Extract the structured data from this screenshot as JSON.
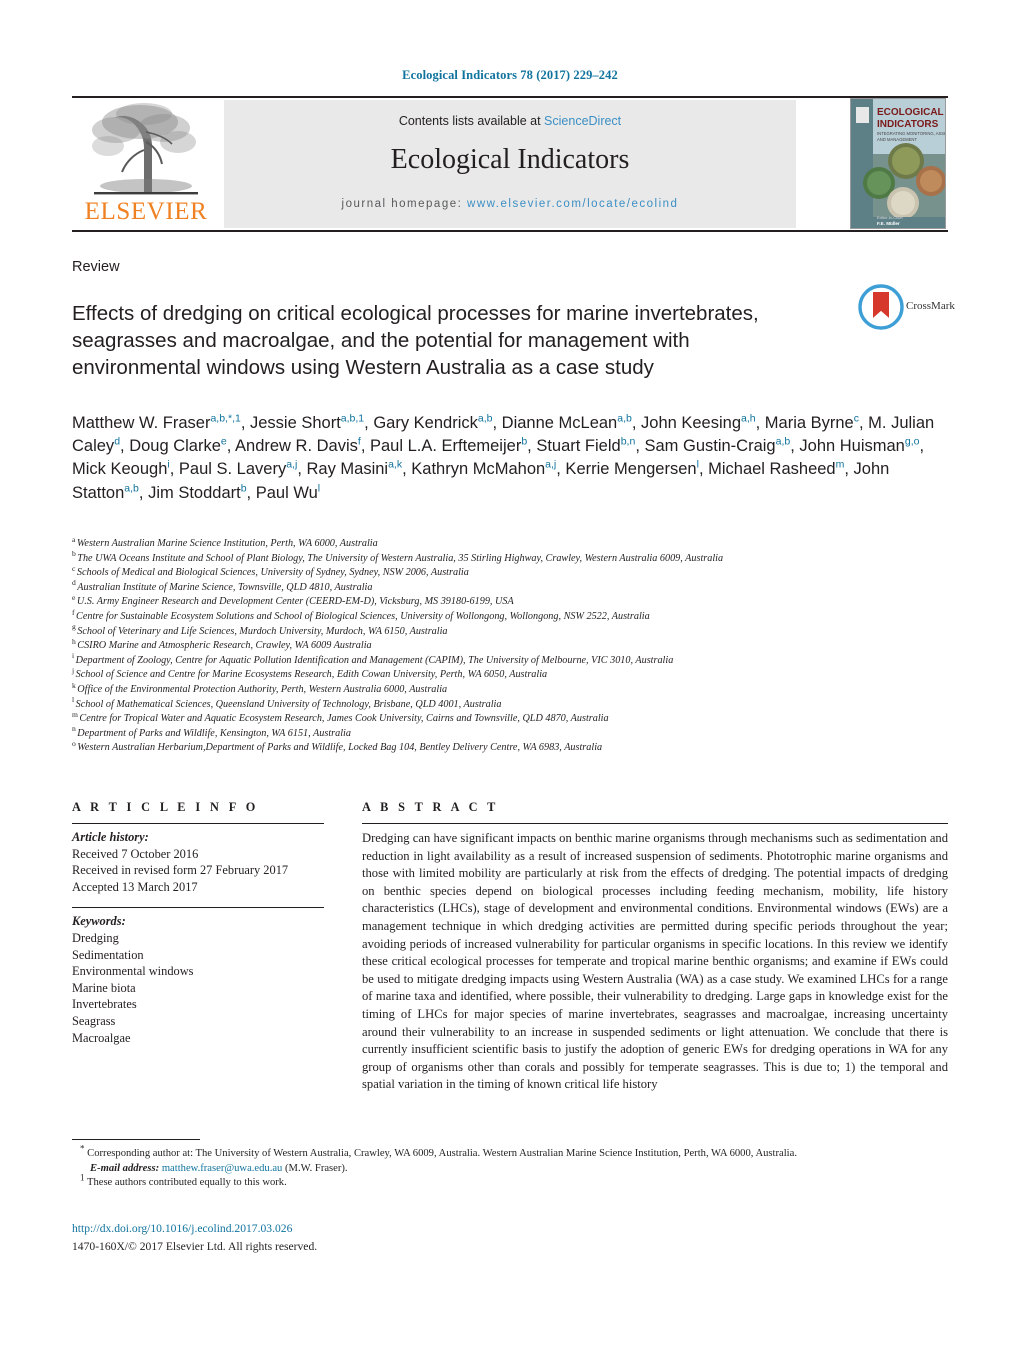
{
  "running_head": "Ecological Indicators 78 (2017) 229–242",
  "masthead": {
    "contents_prefix": "Contents lists available at ",
    "contents_link": "ScienceDirect",
    "journal_title": "Ecological Indicators",
    "homepage_prefix": "journal homepage:",
    "homepage_url": "www.elsevier.com/locate/ecolind",
    "publisher": "ELSEVIER",
    "cover_title_line1": "ECOLOGICAL",
    "cover_title_line2": "INDICATORS"
  },
  "article": {
    "type": "Review",
    "title": "Effects of dredging on critical ecological processes for marine invertebrates, seagrasses and macroalgae, and the potential for management with environmental windows using Western Australia as a case study",
    "crossmark_label": "CrossMark"
  },
  "authors_html": "Matthew W. Fraser<sup>a,b,<span class=\"star\">*</span>,1</sup>, Jessie Short<sup>a,b,1</sup>, Gary Kendrick<sup>a,b</sup>, Dianne McLean<sup>a,b</sup>, John Keesing<sup>a,h</sup>, Maria Byrne<sup>c</sup>, M. Julian Caley<sup>d</sup>, Doug Clarke<sup>e</sup>, Andrew R. Davis<sup>f</sup>, Paul L.A. Erftemeijer<sup>b</sup>, Stuart Field<sup>b,n</sup>, Sam Gustin-Craig<sup>a,b</sup>, John Huisman<sup>g,o</sup>, Mick Keough<sup>i</sup>, Paul S. Lavery<sup>a,j</sup>, Ray Masini<sup>a,k</sup>, Kathryn McMahon<sup>a,j</sup>, Kerrie Mengersen<sup>l</sup>, Michael Rasheed<sup>m</sup>, John Statton<sup>a,b</sup>, Jim Stoddart<sup>b</sup>, Paul Wu<sup>l</sup>",
  "affiliations": [
    {
      "label": "a",
      "text": "Western Australian Marine Science Institution, Perth, WA 6000, Australia"
    },
    {
      "label": "b",
      "text": "The UWA Oceans Institute and School of Plant Biology, The University of Western Australia, 35 Stirling Highway, Crawley, Western Australia 6009, Australia"
    },
    {
      "label": "c",
      "text": "Schools of Medical and Biological Sciences, University of Sydney, Sydney, NSW 2006, Australia"
    },
    {
      "label": "d",
      "text": "Australian Institute of Marine Science, Townsville, QLD 4810, Australia"
    },
    {
      "label": "e",
      "text": "U.S. Army Engineer Research and Development Center (CEERD-EM-D), Vicksburg, MS 39180-6199, USA"
    },
    {
      "label": "f",
      "text": "Centre for Sustainable Ecosystem Solutions and School of Biological Sciences, University of Wollongong, Wollongong, NSW 2522, Australia"
    },
    {
      "label": "g",
      "text": "School of Veterinary and Life Sciences, Murdoch University, Murdoch, WA 6150, Australia"
    },
    {
      "label": "h",
      "text": "CSIRO Marine and Atmospheric Research, Crawley, WA 6009 Australia"
    },
    {
      "label": "i",
      "text": "Department of Zoology, Centre for Aquatic Pollution Identification and Management (CAPIM), The University of Melbourne, VIC 3010, Australia"
    },
    {
      "label": "j",
      "text": "School of Science and Centre for Marine Ecosystems Research, Edith Cowan University, Perth, WA 6050, Australia"
    },
    {
      "label": "k",
      "text": "Office of the Environmental Protection Authority, Perth, Western Australia 6000, Australia"
    },
    {
      "label": "l",
      "text": "School of Mathematical Sciences, Queensland University of Technology, Brisbane, QLD 4001, Australia"
    },
    {
      "label": "m",
      "text": "Centre for Tropical Water and Aquatic Ecosystem Research, James Cook University, Cairns and Townsville, QLD 4870, Australia"
    },
    {
      "label": "n",
      "text": "Department of Parks and Wildlife, Kensington, WA 6151, Australia"
    },
    {
      "label": "o",
      "text": "Western Australian Herbarium,Department of Parks and Wildlife, Locked Bag 104, Bentley Delivery Centre, WA 6983, Australia"
    }
  ],
  "article_info": {
    "heading": "A R T I C L E  I N F O",
    "history_label": "Article history:",
    "history": [
      "Received 7 October 2016",
      "Received in revised form 27 February 2017",
      "Accepted 13 March 2017"
    ],
    "keywords_label": "Keywords:",
    "keywords": [
      "Dredging",
      "Sedimentation",
      "Environmental windows",
      "Marine biota",
      "Invertebrates",
      "Seagrass",
      "Macroalgae"
    ]
  },
  "abstract": {
    "heading": "A B S T R A C T",
    "text": "Dredging can have significant impacts on benthic marine organisms through mechanisms such as sedimentation and reduction in light availability as a result of increased suspension of sediments. Phototrophic marine organisms and those with limited mobility are particularly at risk from the effects of dredging. The potential impacts of dredging on benthic species depend on biological processes including feeding mechanism, mobility, life history characteristics (LHCs), stage of development and environmental conditions. Environmental windows (EWs) are a management technique in which dredging activities are permitted during specific periods throughout the year; avoiding periods of increased vulnerability for particular organisms in specific locations. In this review we identify these critical ecological processes for temperate and tropical marine benthic organisms; and examine if EWs could be used to mitigate dredging impacts using Western Australia (WA) as a case study. We examined LHCs for a range of marine taxa and identified, where possible, their vulnerability to dredging. Large gaps in knowledge exist for the timing of LHCs for major species of marine invertebrates, seagrasses and macroalgae, increasing uncertainty around their vulnerability to an increase in suspended sediments or light attenuation. We conclude that there is currently insufficient scientific basis to justify the adoption of generic EWs for dredging operations in WA for any group of organisms other than corals and possibly for temperate seagrasses. This is due to; 1) the temporal and spatial variation in the timing of known critical life history"
  },
  "footnotes": {
    "corresponding_mark": "*",
    "corresponding_text": "Corresponding author at: The University of Western Australia, Crawley, WA 6009, Australia. Western Australian Marine Science Institution, Perth, WA 6000, Australia.",
    "email_label": "E-mail address:",
    "email": "matthew.fraser@uwa.edu.au",
    "email_suffix": "(M.W. Fraser).",
    "equal_mark": "1",
    "equal_text": "These authors contributed equally to this work."
  },
  "doi": "http://dx.doi.org/10.1016/j.ecolind.2017.03.026",
  "copyright": "1470-160X/© 2017 Elsevier Ltd. All rights reserved."
}
